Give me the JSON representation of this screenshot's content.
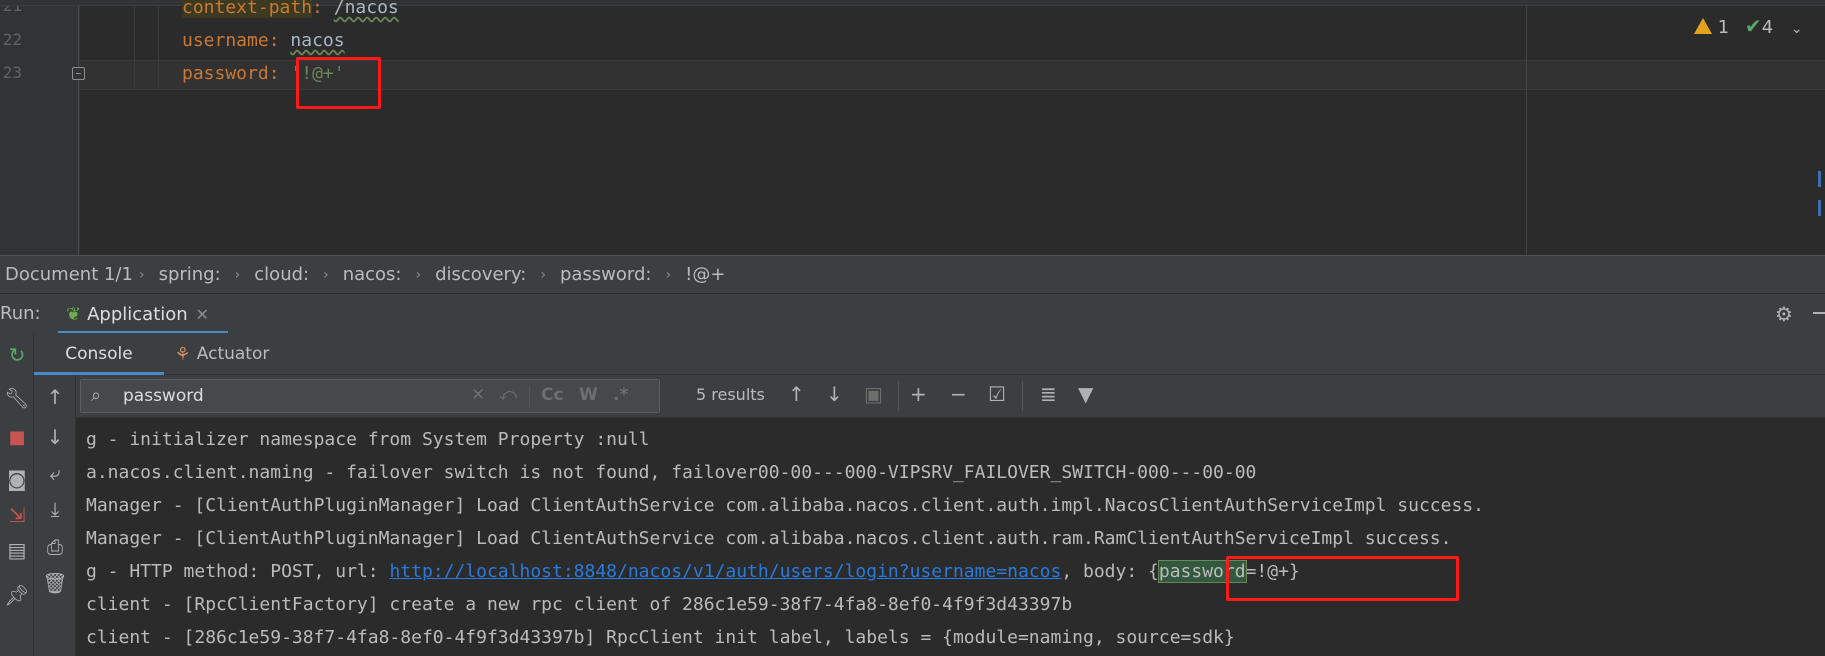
{
  "editor": {
    "line_numbers": [
      "21",
      "22",
      "23"
    ],
    "lines": [
      {
        "key": "context-path",
        "sep": ": ",
        "value": "/nacos"
      },
      {
        "key": "username",
        "sep": ": ",
        "value": "nacos"
      },
      {
        "key": "password",
        "sep": ": ",
        "value": "'!@+'"
      }
    ],
    "inspections": {
      "warnings": "1",
      "checks": "4"
    }
  },
  "breadcrumb": {
    "document": "Document 1/1",
    "items": [
      "spring:",
      "cloud:",
      "nacos:",
      "discovery:",
      "password:",
      "!@+"
    ]
  },
  "run": {
    "label": "Run:",
    "tab": "Application",
    "subtabs": {
      "console": "Console",
      "actuator": "Actuator"
    }
  },
  "search": {
    "value": "password",
    "results": "5 results",
    "case_label": "Cc",
    "word_label": "W",
    "regex_label": ".*"
  },
  "console": {
    "lines": [
      "g - initializer namespace from System Property :null",
      "a.nacos.client.naming - failover switch is not found, failover00-00---000-VIPSRV_FAILOVER_SWITCH-000---00-00",
      "Manager - [ClientAuthPluginManager] Load ClientAuthService com.alibaba.nacos.client.auth.impl.NacosClientAuthServiceImpl success.",
      "Manager - [ClientAuthPluginManager] Load ClientAuthService com.alibaba.nacos.client.auth.ram.RamClientAuthServiceImpl success."
    ],
    "http_line": {
      "prefix": "g - HTTP method: POST, url: ",
      "url": "http://localhost:8848/nacos/v1/auth/users/login?username=nacos",
      "middle": ", body: {",
      "match": "password",
      "suffix": "=!@+}"
    },
    "lines_after": [
      "client - [RpcClientFactory] create a new rpc client of 286c1e59-38f7-4fa8-8ef0-4f9f3d43397b",
      "client - [286c1e59-38f7-4fa8-8ef0-4f9f3d43397b] RpcClient init label, labels = {module=naming, source=sdk}"
    ]
  },
  "colors": {
    "background": "#2b2b2b",
    "key": "#cc7832",
    "string": "#6a8759",
    "link": "#287bde",
    "annotation_box": "#ff1a1a",
    "tab_underline": "#4a88c7"
  }
}
